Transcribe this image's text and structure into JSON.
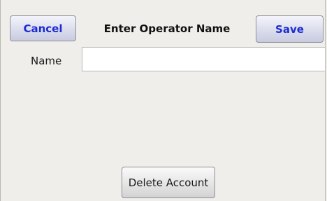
{
  "header": {
    "cancel_label": "Cancel",
    "title": "Enter Operator Name",
    "save_label": "Save"
  },
  "form": {
    "name_label": "Name",
    "name_value": ""
  },
  "footer": {
    "delete_label": "Delete Account"
  },
  "colors": {
    "background": "#f0eeeb",
    "button_text_accent": "#1d2bd1"
  }
}
